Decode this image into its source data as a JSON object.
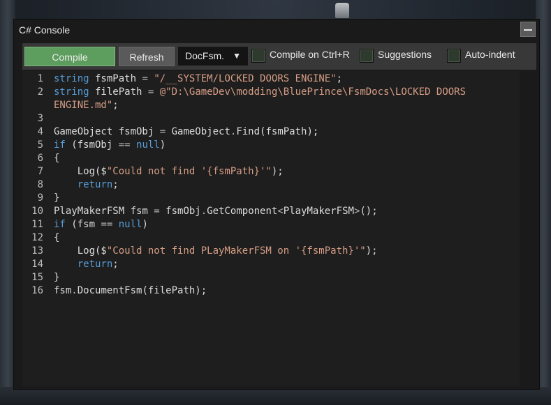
{
  "window": {
    "title": "C# Console"
  },
  "toolbar": {
    "compile_label": "Compile",
    "refresh_label": "Refresh",
    "doc_select": "DocFsm.",
    "checkboxes": [
      {
        "label": "Compile on Ctrl+R",
        "checked": false
      },
      {
        "label": "Suggestions",
        "checked": false
      },
      {
        "label": "Auto-indent",
        "checked": false
      }
    ]
  },
  "editor": {
    "lines": [
      "1",
      "2",
      "",
      "3",
      "4",
      "5",
      "6",
      "7",
      "8",
      "9",
      "10",
      "11",
      "12",
      "13",
      "14",
      "15",
      "16"
    ]
  },
  "colors": {
    "keyword": "#569cd6",
    "string": "#d69d85",
    "compile": "#5d9d5d"
  }
}
